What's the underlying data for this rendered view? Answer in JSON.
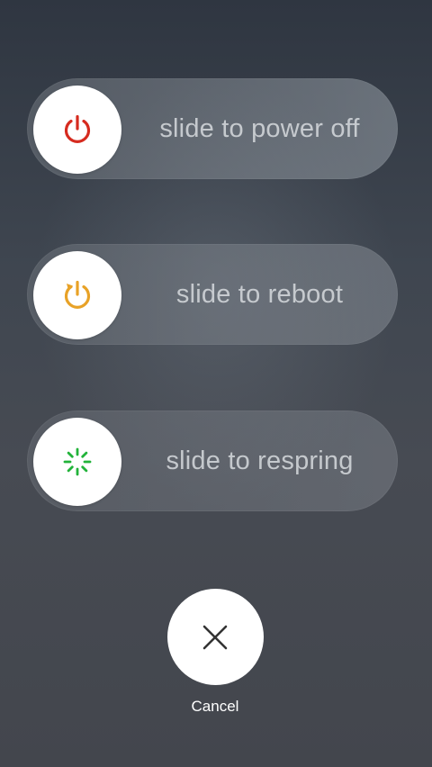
{
  "sliders": [
    {
      "label": "slide to power off",
      "icon": "power-icon",
      "icon_color": "#d62b1f"
    },
    {
      "label": "slide to reboot",
      "icon": "reboot-icon",
      "icon_color": "#e8a227"
    },
    {
      "label": "slide to respring",
      "icon": "spinner-icon",
      "icon_color": "#22b33a"
    }
  ],
  "cancel": {
    "label": "Cancel",
    "icon": "close-icon"
  }
}
